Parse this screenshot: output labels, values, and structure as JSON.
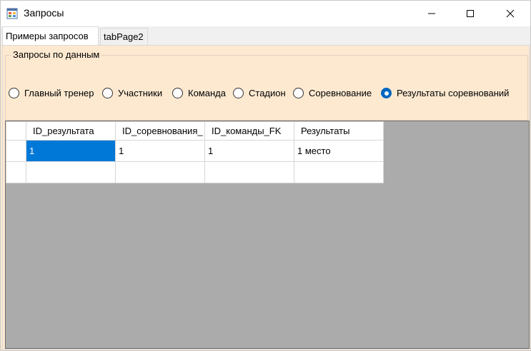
{
  "window": {
    "title": "Запросы"
  },
  "tabs": [
    {
      "label": "Примеры запросов",
      "active": true
    },
    {
      "label": "tabPage2",
      "active": false
    }
  ],
  "group": {
    "title": "Запросы по данным",
    "options": [
      {
        "label": "Главный тренер",
        "checked": false
      },
      {
        "label": "Участники",
        "checked": false
      },
      {
        "label": "Команда",
        "checked": false
      },
      {
        "label": "Стадион",
        "checked": false
      },
      {
        "label": "Соревнование",
        "checked": false
      },
      {
        "label": "Результаты соревнований",
        "checked": true
      }
    ]
  },
  "grid": {
    "columns": [
      "ID_результата",
      "ID_соревнования_",
      "ID_команды_FK",
      "Результаты"
    ],
    "rows": [
      [
        "1",
        "1",
        "1",
        "1 место"
      ],
      [
        "",
        "",
        "",
        ""
      ]
    ]
  },
  "colors": {
    "background": "#fde9d0",
    "accent": "#0067c0",
    "selection": "#0078d7",
    "grid_background": "#ababab"
  }
}
